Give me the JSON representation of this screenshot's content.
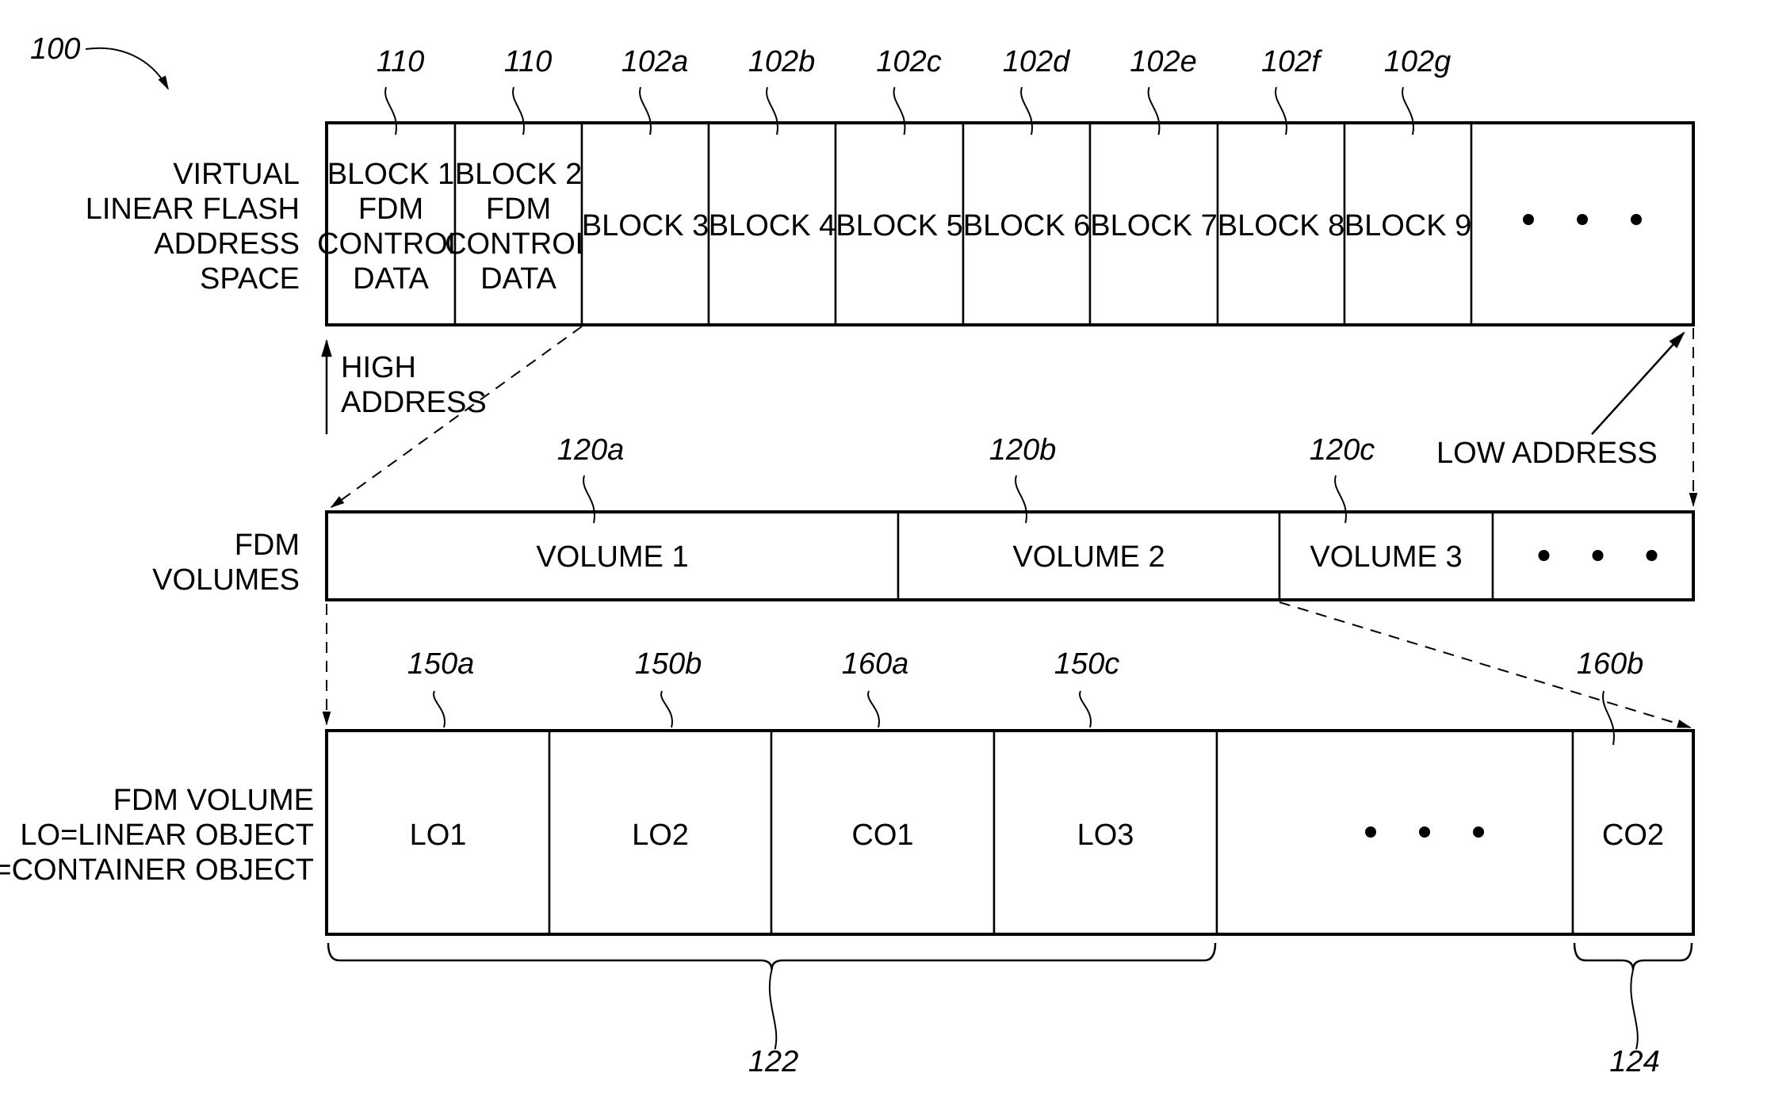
{
  "figure": {
    "reference_number": "100"
  },
  "rows": {
    "virtual_space": {
      "label_lines": [
        "VIRTUAL",
        "LINEAR FLASH",
        "ADDRESS",
        "SPACE"
      ],
      "blocks": [
        {
          "lines": [
            "BLOCK 1",
            "FDM",
            "CONTROL",
            "DATA"
          ],
          "ref": "110"
        },
        {
          "lines": [
            "BLOCK 2",
            "FDM",
            "CONTROL",
            "DATA"
          ],
          "ref": "110"
        },
        {
          "lines": [
            "BLOCK 3"
          ],
          "ref": "102a"
        },
        {
          "lines": [
            "BLOCK 4"
          ],
          "ref": "102b"
        },
        {
          "lines": [
            "BLOCK 5"
          ],
          "ref": "102c"
        },
        {
          "lines": [
            "BLOCK 6"
          ],
          "ref": "102d"
        },
        {
          "lines": [
            "BLOCK 7"
          ],
          "ref": "102e"
        },
        {
          "lines": [
            "BLOCK 8"
          ],
          "ref": "102f"
        },
        {
          "lines": [
            "BLOCK 9"
          ],
          "ref": "102g"
        },
        {
          "lines": [],
          "ellipsis": true,
          "ref": ""
        }
      ]
    },
    "address_labels": {
      "high_lines": [
        "HIGH",
        "ADDRESS"
      ],
      "low": "LOW ADDRESS"
    },
    "fdm_volumes": {
      "label_lines": [
        "FDM",
        "VOLUMES"
      ],
      "volumes": [
        {
          "label": "VOLUME 1",
          "ref": "120a"
        },
        {
          "label": "VOLUME 2",
          "ref": "120b"
        },
        {
          "label": "VOLUME 3",
          "ref": "120c"
        },
        {
          "label": "",
          "ellipsis": true,
          "ref": ""
        }
      ]
    },
    "fdm_volume": {
      "label_lines": [
        "FDM VOLUME",
        "LO=LINEAR OBJECT",
        "CO=CONTAINER OBJECT"
      ],
      "objects": [
        {
          "label": "LO1",
          "ref": "150a"
        },
        {
          "label": "LO2",
          "ref": "150b"
        },
        {
          "label": "CO1",
          "ref": "160a"
        },
        {
          "label": "LO3",
          "ref": "150c"
        },
        {
          "label": "",
          "ellipsis": true,
          "ref": ""
        },
        {
          "label": "CO2",
          "ref": "160b"
        }
      ],
      "braces": [
        {
          "ref": "122"
        },
        {
          "ref": "124"
        }
      ]
    }
  }
}
